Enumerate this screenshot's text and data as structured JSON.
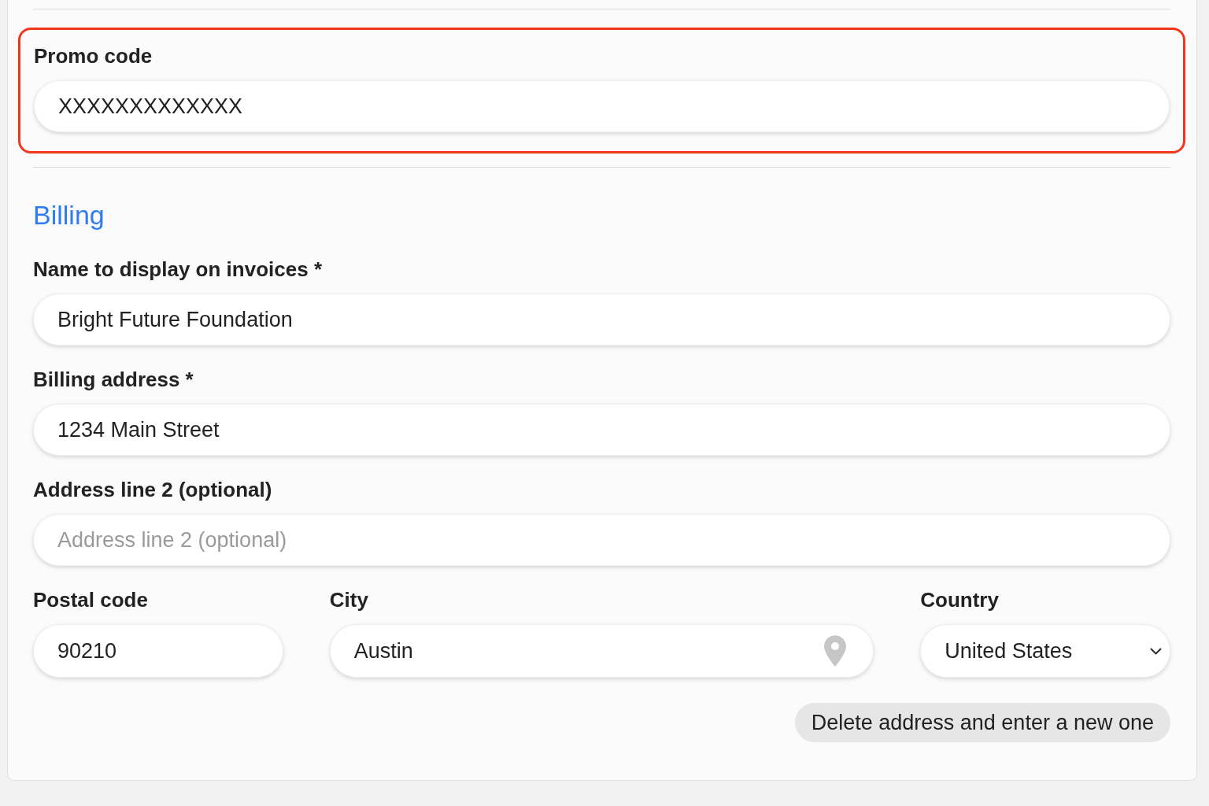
{
  "promo_code": {
    "label": "Promo code",
    "value": "XXXXXXXXXXXXX",
    "highlighted": true
  },
  "billing": {
    "heading": "Billing",
    "fields": [
      {
        "label": "Name to display on invoices *",
        "value": "Bright Future Foundation"
      },
      {
        "label": "Billing address *",
        "value": "1234 Main Street"
      },
      {
        "label": "Address line 2 (optional)",
        "placeholder": "Address line 2 (optional)"
      }
    ],
    "address_row": [
      {
        "kind": "text",
        "label": "Postal code",
        "value": "90210"
      },
      {
        "kind": "location",
        "label": "City",
        "value": "Austin"
      },
      {
        "kind": "select",
        "label": "Country",
        "value": "United States"
      }
    ],
    "delete_button": "Delete address and enter a new one"
  }
}
